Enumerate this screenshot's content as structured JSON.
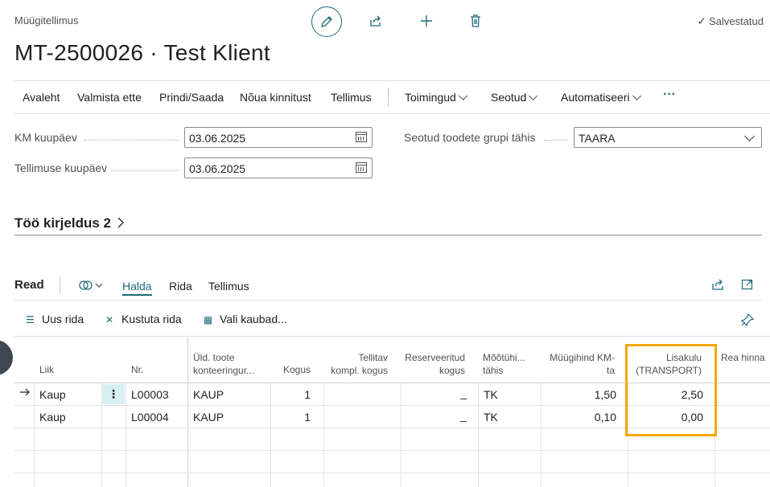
{
  "header": {
    "subtitle": "Müügitellimus",
    "title": "MT-2500026 · Test Klient",
    "saved": "Salvestatud",
    "icons": [
      "edit-icon",
      "share-icon",
      "new-icon",
      "delete-icon"
    ]
  },
  "actions": [
    "Avaleht",
    "Valmista ette",
    "Prindi/Saada",
    "Nõua kinnitust",
    "Tellimus"
  ],
  "menus": [
    "Toimingud",
    "Seotud",
    "Automatiseeri"
  ],
  "more": "···",
  "fields": {
    "vat_date": {
      "label": "KM kuupäev",
      "value": "03.06.2025"
    },
    "order_date": {
      "label": "Tellimuse kuupäev",
      "value": "03.06.2025"
    },
    "item_group": {
      "label": "Seotud toodete grupi tähis",
      "value": "TAARA"
    }
  },
  "section": {
    "title": "Töö kirjeldus 2"
  },
  "lines": {
    "title": "Read",
    "tabs": [
      "Halda",
      "Rida",
      "Tellimus"
    ],
    "actions": [
      "Uus rida",
      "Kustuta rida",
      "Vali kaubad..."
    ],
    "columns": {
      "type": "Liik",
      "no": "Nr.",
      "gen_l1": "Üld. toote",
      "gen_l2": "konteeringur...",
      "qty": "Kogus",
      "asm_l1": "Tellitav",
      "asm_l2": "kompl. kogus",
      "res_l1": "Reserveeritud",
      "res_l2": "kogus",
      "uom_l1": "Mõõtühi...",
      "uom_l2": "tähis",
      "price_l1": "Müügihind KM-",
      "price_l2": "ta",
      "extra_l1": "Lisakulu",
      "extra_l2": "(TRANSPORT)",
      "disc": "Rea hinna"
    },
    "rows": [
      {
        "type": "Kaup",
        "no": "L00003",
        "gen": "KAUP",
        "qty": "1",
        "res": "_",
        "uom": "TK",
        "price": "1,50",
        "extra": "2,50"
      },
      {
        "type": "Kaup",
        "no": "L00004",
        "gen": "KAUP",
        "qty": "1",
        "res": "_",
        "uom": "TK",
        "price": "0,10",
        "extra": "0,00"
      }
    ]
  },
  "colors": {
    "accent": "#1f6a78",
    "highlight": "#f5a800"
  }
}
